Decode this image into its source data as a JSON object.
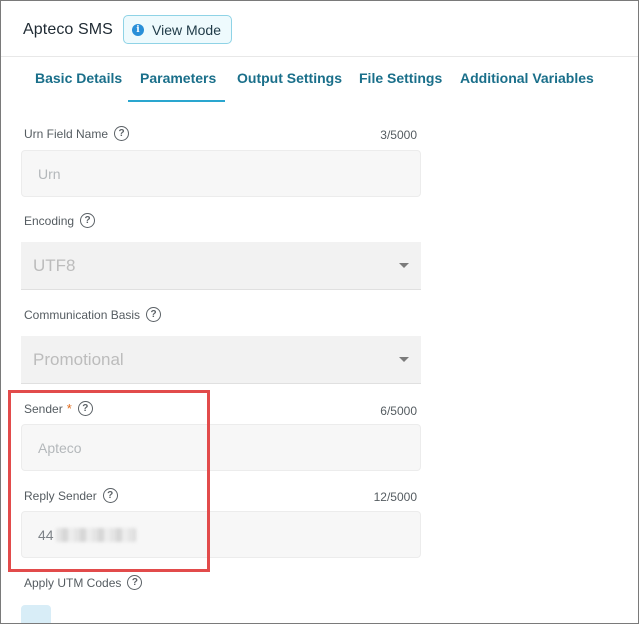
{
  "header": {
    "app_title": "Apteco SMS",
    "mode_badge": "View Mode",
    "mode_icon": "info-icon"
  },
  "tabs": [
    {
      "label": "Basic Details"
    },
    {
      "label": "Parameters",
      "active": true
    },
    {
      "label": "Output Settings"
    },
    {
      "label": "File Settings"
    },
    {
      "label": "Additional Variables"
    }
  ],
  "fields": {
    "urn": {
      "label": "Urn Field Name",
      "counter": "3/5000",
      "value": "Urn"
    },
    "encoding": {
      "label": "Encoding",
      "value": "UTF8"
    },
    "communication_basis": {
      "label": "Communication Basis",
      "value": "Promotional"
    },
    "sender": {
      "label": "Sender",
      "required_mark": "*",
      "counter": "6/5000",
      "value": "Apteco"
    },
    "reply_sender": {
      "label": "Reply Sender",
      "counter": "12/5000",
      "value": "44"
    },
    "apply_utm": {
      "label": "Apply UTM Codes"
    }
  },
  "help_glyph": "?",
  "colors": {
    "accent": "#1a6f8a",
    "tab_underline": "#2aa6cf",
    "highlight": "#e24b4b",
    "required": "#e06a1b"
  }
}
